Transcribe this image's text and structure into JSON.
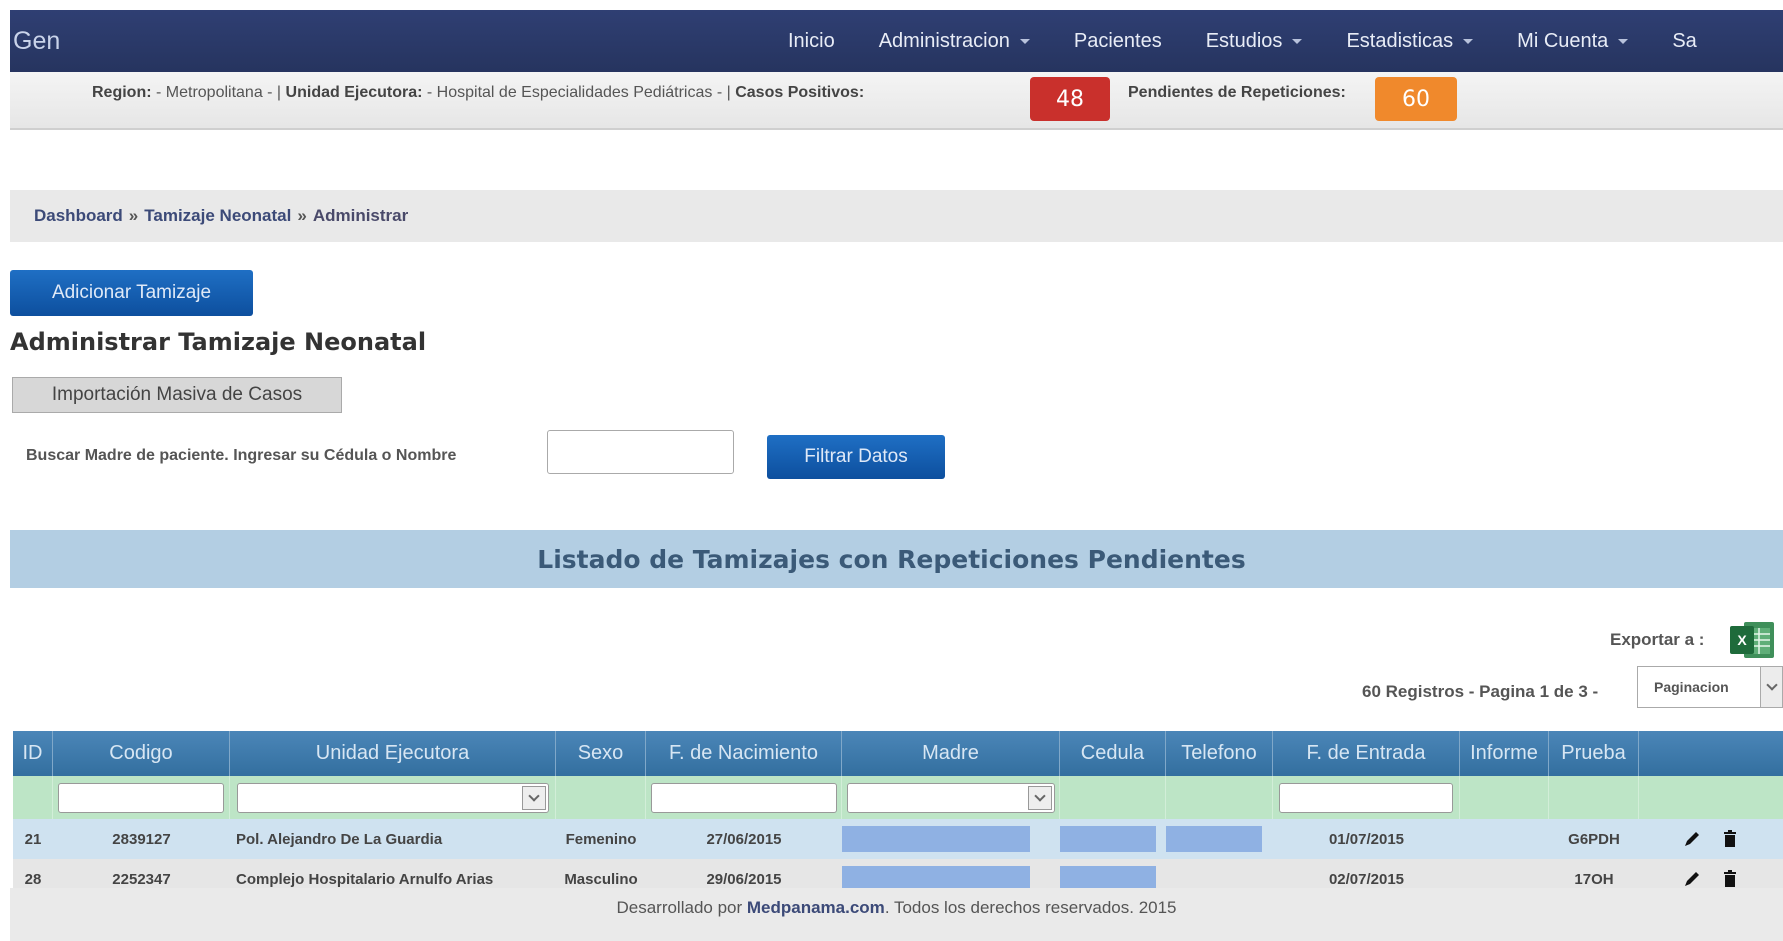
{
  "app": {
    "brand": "Gen"
  },
  "nav": {
    "items": [
      {
        "label": "Inicio",
        "has_caret": false
      },
      {
        "label": "Administracion",
        "has_caret": true
      },
      {
        "label": "Pacientes",
        "has_caret": false
      },
      {
        "label": "Estudios",
        "has_caret": true
      },
      {
        "label": "Estadisticas",
        "has_caret": true
      },
      {
        "label": "Mi Cuenta",
        "has_caret": true
      },
      {
        "label": "Sa",
        "has_caret": false
      }
    ]
  },
  "info": {
    "region_label": "Region:",
    "region_value": " - Metropolitana - |",
    "unidad_label": "Unidad Ejecutora:",
    "unidad_value": " - Hospital de Especialidades Pediátricas - |",
    "positivos_label": "Casos Positivos:",
    "positivos_count": "48",
    "pendientes_label": "Pendientes de Repeticiones:",
    "pendientes_count": "60",
    "colors": {
      "positivos": "#c9302c",
      "pendientes": "#f0892c"
    }
  },
  "breadcrumb": {
    "items": [
      "Dashboard",
      "Tamizaje Neonatal",
      "Administrar"
    ],
    "separator": "»"
  },
  "actions": {
    "add_label": "Adicionar Tamizaje",
    "import_label": "Importación Masiva de Casos",
    "filter_label": "Filtrar Datos"
  },
  "page": {
    "title": "Administrar Tamizaje Neonatal"
  },
  "search": {
    "label": "Buscar Madre de paciente. Ingresar su Cédula o Nombre",
    "value": ""
  },
  "list": {
    "title": "Listado de Tamizajes con Repeticiones Pendientes",
    "export_label": "Exportar a :",
    "export_icon": "excel-icon",
    "records_label": "60 Registros - Pagina 1 de 3 -",
    "pagination_selected": "Paginacion"
  },
  "table": {
    "columns": [
      "ID",
      "Codigo",
      "Unidad Ejecutora",
      "Sexo",
      "F. de Nacimiento",
      "Madre",
      "Cedula",
      "Telefono",
      "F. de Entrada",
      "Informe",
      "Prueba",
      ""
    ],
    "rows": [
      {
        "id": "21",
        "codigo": "2839127",
        "unidad": "Pol. Alejandro De La Guardia",
        "sexo": "Femenino",
        "nacimiento": "27/06/2015",
        "madre": "",
        "cedula": "",
        "telefono": "",
        "entrada": "01/07/2015",
        "informe": "",
        "prueba": "G6PDH"
      },
      {
        "id": "28",
        "codigo": "2252347",
        "unidad": "Complejo Hospitalario Arnulfo Arias",
        "sexo": "Masculino",
        "nacimiento": "29/06/2015",
        "madre": "",
        "cedula": "",
        "telefono": "",
        "entrada": "02/07/2015",
        "informe": "",
        "prueba": "17OH"
      }
    ]
  },
  "footer": {
    "prefix": "Desarrollado por ",
    "company": "Medpanama.com",
    "suffix": ". Todos los derechos reservados. 2015"
  }
}
